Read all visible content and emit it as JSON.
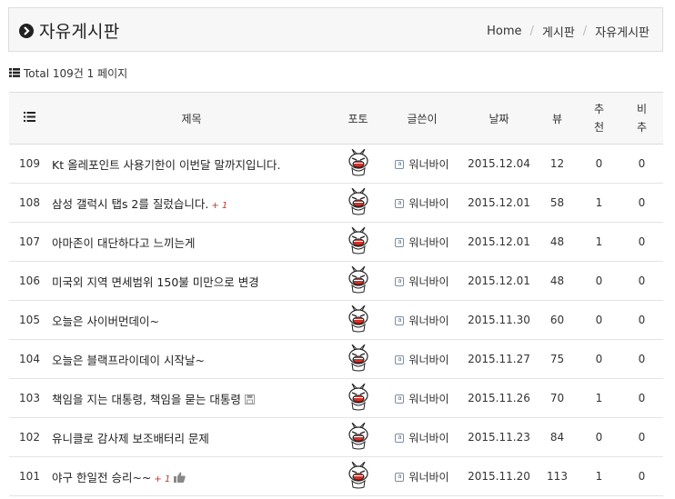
{
  "header": {
    "title": "자유게시판",
    "breadcrumb": [
      "Home",
      "게시판",
      "자유게시판"
    ]
  },
  "summary": {
    "total_text": "Total 109건 1 페이지"
  },
  "table": {
    "columns": {
      "subject": "제목",
      "photo": "포토",
      "author": "글쓴이",
      "date": "날짜",
      "views": "뷰",
      "recommend_1": "추",
      "recommend_2": "천",
      "dislike_1": "비",
      "dislike_2": "추"
    },
    "rows": [
      {
        "num": "109",
        "subject": "Kt 올레포인트 사용기한이 이번달 말까지입니다.",
        "comment": "",
        "icon": "",
        "author": "워너바이",
        "date": "2015.12.04",
        "views": "12",
        "recommend": "0",
        "dislike": "0"
      },
      {
        "num": "108",
        "subject": "삼성 갤럭시 탭s 2를 질렀습니다.",
        "comment": "+ 1",
        "icon": "",
        "author": "워너바이",
        "date": "2015.12.01",
        "views": "58",
        "recommend": "1",
        "dislike": "0"
      },
      {
        "num": "107",
        "subject": "아마존이 대단하다고 느끼는게",
        "comment": "",
        "icon": "",
        "author": "워너바이",
        "date": "2015.12.01",
        "views": "48",
        "recommend": "1",
        "dislike": "0"
      },
      {
        "num": "106",
        "subject": "미국외 지역 면세범위 150불 미만으로 변경",
        "comment": "",
        "icon": "",
        "author": "워너바이",
        "date": "2015.12.01",
        "views": "48",
        "recommend": "0",
        "dislike": "0"
      },
      {
        "num": "105",
        "subject": "오늘은 사이버먼데이~",
        "comment": "",
        "icon": "",
        "author": "워너바이",
        "date": "2015.11.30",
        "views": "60",
        "recommend": "0",
        "dislike": "0"
      },
      {
        "num": "104",
        "subject": "오늘은 블랙프라이데이 시작날~",
        "comment": "",
        "icon": "",
        "author": "워너바이",
        "date": "2015.11.27",
        "views": "75",
        "recommend": "0",
        "dislike": "0"
      },
      {
        "num": "103",
        "subject": "책임을 지는 대통령, 책임을 묻는 대통령",
        "comment": "",
        "icon": "floppy-disk-icon",
        "author": "워너바이",
        "date": "2015.11.26",
        "views": "70",
        "recommend": "1",
        "dislike": "0"
      },
      {
        "num": "102",
        "subject": "유니클로 감사제 보조배터리 문제",
        "comment": "",
        "icon": "",
        "author": "워너바이",
        "date": "2015.11.23",
        "views": "84",
        "recommend": "0",
        "dislike": "0"
      },
      {
        "num": "101",
        "subject": "야구 한일전 승리~~",
        "comment": "+ 1",
        "icon": "thumbs-up-icon",
        "author": "워너바이",
        "date": "2015.11.20",
        "views": "113",
        "recommend": "1",
        "dislike": "0"
      }
    ]
  }
}
